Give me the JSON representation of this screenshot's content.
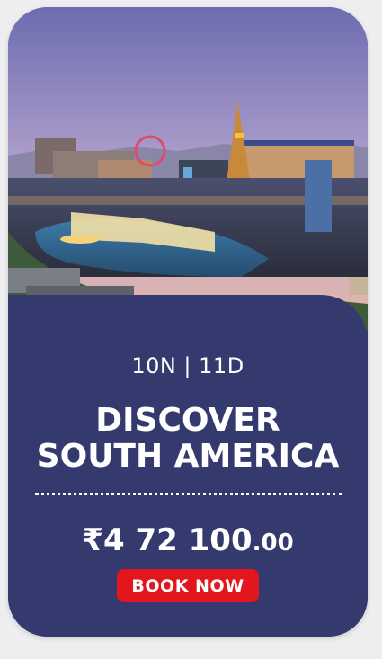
{
  "card": {
    "duration": "10N | 11D",
    "title_line1": "DISCOVER",
    "title_line2": "SOUTH AMERICA",
    "price_currency": "₹",
    "price_main": "4 72 100",
    "price_decimal": ".00",
    "book_label": "BOOK NOW"
  },
  "colors": {
    "panel": "#353a6e",
    "button": "#e3161d"
  },
  "icons": {
    "hero": "las-vegas-skyline-photo"
  }
}
